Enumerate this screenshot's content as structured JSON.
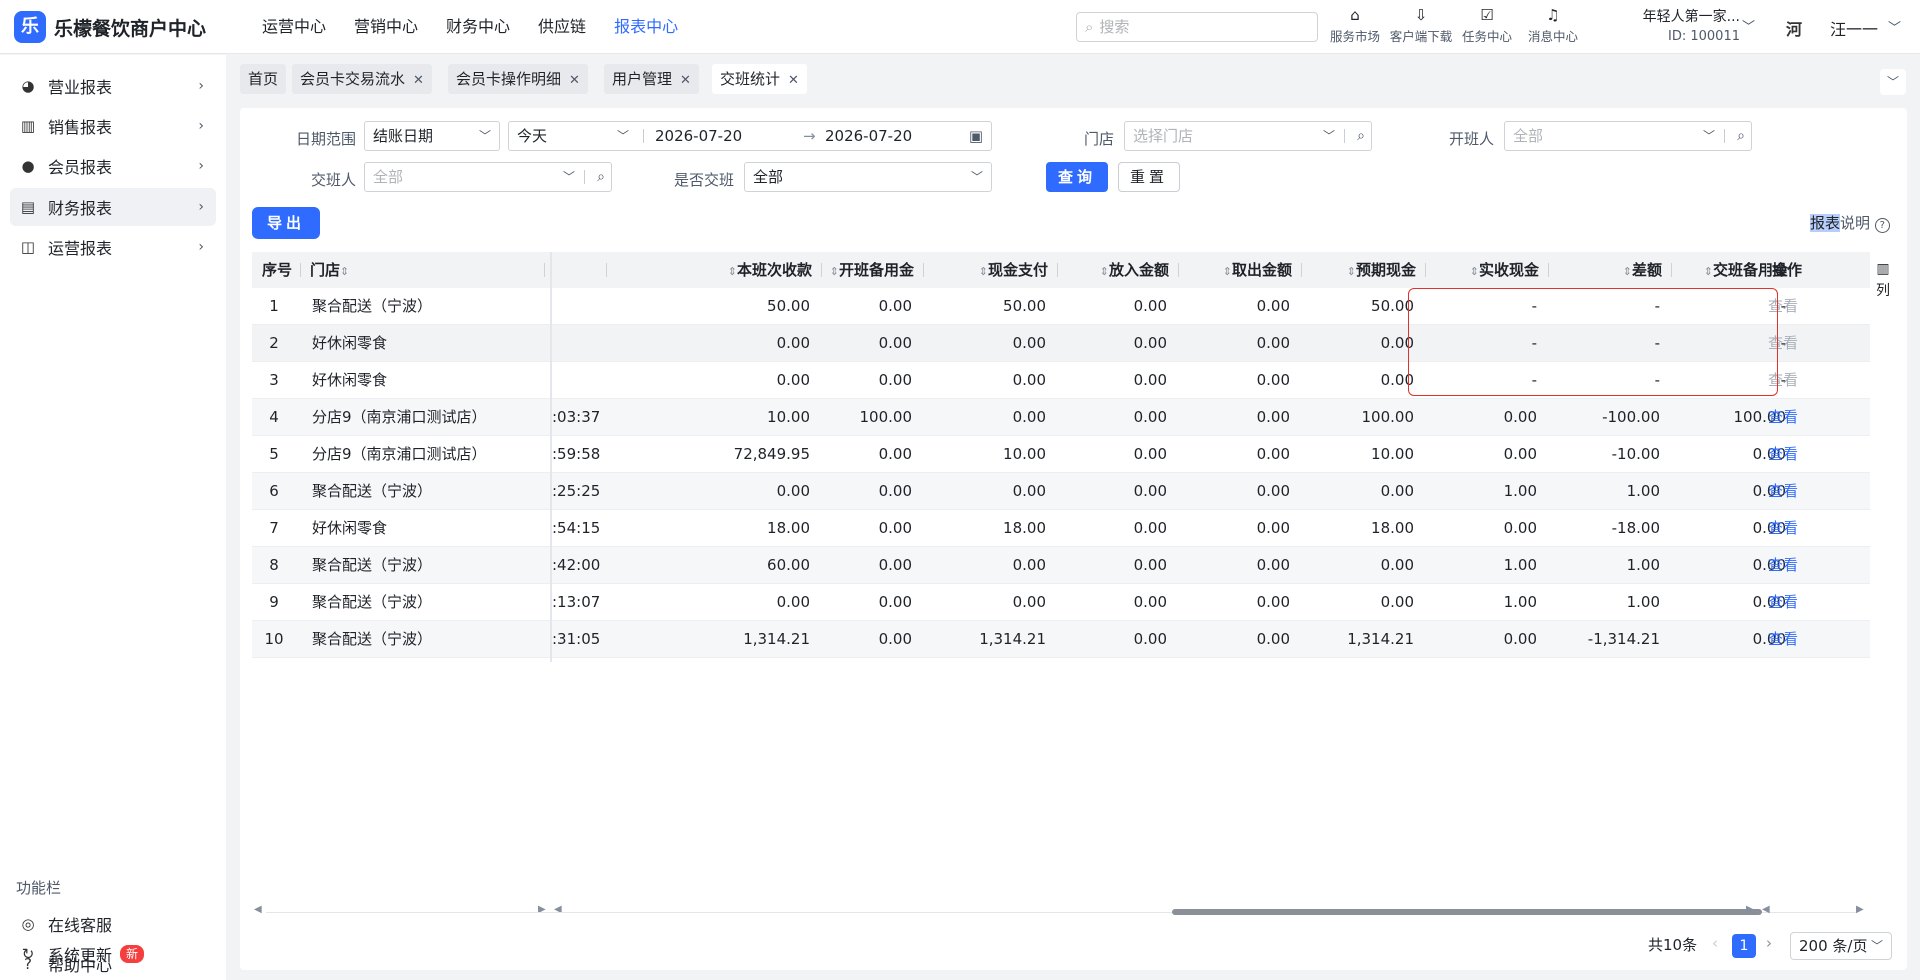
{
  "app": {
    "logo_glyph": "乐",
    "brand": "乐檬餐饮商户中心"
  },
  "topnav": [
    "运营中心",
    "营销中心",
    "财务中心",
    "供应链",
    "报表中心"
  ],
  "search": {
    "placeholder": "搜索"
  },
  "tools": [
    {
      "icon": "shop-bag-icon",
      "glyph": "⌂",
      "label": "服务市场"
    },
    {
      "icon": "folder-download-icon",
      "glyph": "⇩",
      "label": "客户端下载"
    },
    {
      "icon": "clipboard-check-icon",
      "glyph": "☑",
      "label": "任务中心"
    },
    {
      "icon": "bell-icon",
      "glyph": "♫",
      "label": "消息中心"
    }
  ],
  "tenant": {
    "name": "年轻人第一家...",
    "id": "ID: 100011"
  },
  "user": {
    "avatar": "河",
    "name": "汪一一"
  },
  "sidebar": {
    "items": [
      {
        "glyph": "◕",
        "label": "营业报表"
      },
      {
        "glyph": "▥",
        "label": "销售报表"
      },
      {
        "glyph": "●",
        "label": "会员报表"
      },
      {
        "glyph": "▤",
        "label": "财务报表"
      },
      {
        "glyph": "◫",
        "label": "运营报表"
      }
    ],
    "func_title": "功能栏",
    "func_items": [
      {
        "glyph": "◎",
        "label": "在线客服"
      },
      {
        "glyph": "?",
        "label": "帮助中心"
      },
      {
        "glyph": "↻",
        "label": "系统更新",
        "badge": "新"
      }
    ]
  },
  "tabs": [
    "首页",
    "会员卡交易流水",
    "会员卡操作明细",
    "用户管理",
    "交班统计"
  ],
  "filters": {
    "date_label": "日期范围",
    "date_type": "结账日期",
    "date_preset": "今天",
    "date_from": "2026-07-20",
    "date_to": "2026-07-20",
    "store_label": "门店",
    "store_placeholder": "选择门店",
    "opener_label": "开班人",
    "opener_placeholder": "全部",
    "handover_label": "交班人",
    "handover_placeholder": "全部",
    "ishandover_label": "是否交班",
    "ishandover_value": "全部",
    "query": "查询",
    "reset": "重置",
    "export": "导出"
  },
  "report_desc": {
    "hl": "报表",
    "rest": "说明",
    "icon": "?"
  },
  "table": {
    "headers": {
      "seq": "序号",
      "store": "门店",
      "cols": [
        "本班次收款",
        "开班备用金",
        "现金支付",
        "放入金额",
        "取出金额",
        "预期现金",
        "实收现金",
        "差额",
        "交班备用金"
      ],
      "op": "操作"
    },
    "rows": [
      {
        "seq": "1",
        "store": "聚合配送（宁波）",
        "time": "",
        "v": [
          "50.00",
          "0.00",
          "50.00",
          "0.00",
          "0.00",
          "50.00",
          "-",
          "-",
          "-"
        ],
        "op": "查看"
      },
      {
        "seq": "2",
        "store": "好休闲零食",
        "time": "",
        "v": [
          "0.00",
          "0.00",
          "0.00",
          "0.00",
          "0.00",
          "0.00",
          "-",
          "-",
          "-"
        ],
        "op": "查看"
      },
      {
        "seq": "3",
        "store": "好休闲零食",
        "time": "",
        "v": [
          "0.00",
          "0.00",
          "0.00",
          "0.00",
          "0.00",
          "0.00",
          "-",
          "-",
          "-"
        ],
        "op": "查看"
      },
      {
        "seq": "4",
        "store": "分店9（南京浦口测试店）",
        "time": ":03:37",
        "v": [
          "10.00",
          "100.00",
          "0.00",
          "0.00",
          "0.00",
          "100.00",
          "0.00",
          "-100.00",
          "100.00"
        ],
        "op": "查看"
      },
      {
        "seq": "5",
        "store": "分店9（南京浦口测试店）",
        "time": ":59:58",
        "v": [
          "72,849.95",
          "0.00",
          "10.00",
          "0.00",
          "0.00",
          "10.00",
          "0.00",
          "-10.00",
          "0.00"
        ],
        "op": "查看"
      },
      {
        "seq": "6",
        "store": "聚合配送（宁波）",
        "time": ":25:25",
        "v": [
          "0.00",
          "0.00",
          "0.00",
          "0.00",
          "0.00",
          "0.00",
          "1.00",
          "1.00",
          "0.00"
        ],
        "op": "查看"
      },
      {
        "seq": "7",
        "store": "好休闲零食",
        "time": ":54:15",
        "v": [
          "18.00",
          "0.00",
          "18.00",
          "0.00",
          "0.00",
          "18.00",
          "0.00",
          "-18.00",
          "0.00"
        ],
        "op": "查看"
      },
      {
        "seq": "8",
        "store": "聚合配送（宁波）",
        "time": ":42:00",
        "v": [
          "60.00",
          "0.00",
          "0.00",
          "0.00",
          "0.00",
          "0.00",
          "1.00",
          "1.00",
          "0.00"
        ],
        "op": "查看"
      },
      {
        "seq": "9",
        "store": "聚合配送（宁波）",
        "time": ":13:07",
        "v": [
          "0.00",
          "0.00",
          "0.00",
          "0.00",
          "0.00",
          "0.00",
          "1.00",
          "1.00",
          "0.00"
        ],
        "op": "查看"
      },
      {
        "seq": "10",
        "store": "聚合配送（宁波）",
        "time": ":31:05",
        "v": [
          "1,314.21",
          "0.00",
          "1,314.21",
          "0.00",
          "0.00",
          "1,314.21",
          "0.00",
          "-1,314.21",
          "0.00"
        ],
        "op": "查看"
      }
    ],
    "col_setting": "列"
  },
  "pagination": {
    "total": "共10条",
    "page": "1",
    "size": "200 条/页"
  },
  "colors": {
    "accent": "#2f6bff",
    "highlight_box": "#e0322c"
  }
}
